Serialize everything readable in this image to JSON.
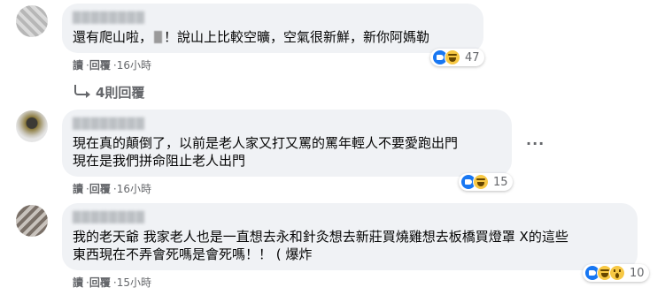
{
  "comments": [
    {
      "text_before": "還有爬山啦，",
      "text_after": "！說山上比較空曠，空氣很新鮮，新你阿媽勒",
      "read_label": "讀",
      "reply_label": "回覆",
      "time": "16小時",
      "reaction_count": "47"
    },
    {
      "text": "現在真的顛倒了，以前是老人家又打又罵的罵年輕人不要愛跑出門\n現在是我們拼命阻止老人出門",
      "read_label": "讀",
      "reply_label": "回覆",
      "time": "16小時",
      "reaction_count": "15",
      "more_glyph": "···"
    },
    {
      "text": "我的老天爺 我家老人也是一直想去永和針灸想去新莊買燒雞想去板橋買燈罩 X的這些\n東西現在不弄會死嗎是會死嗎！！ ( 爆炸",
      "read_label": "讀",
      "reply_label": "回覆",
      "time": "15小時",
      "reaction_count": "10"
    }
  ],
  "replies_link": "4則回覆",
  "separator": "·",
  "author_placeholder": "████████"
}
